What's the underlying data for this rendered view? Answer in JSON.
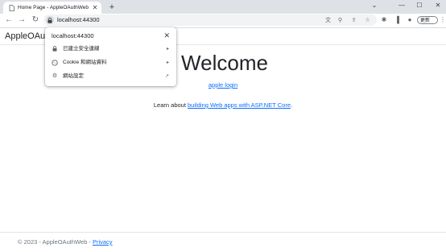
{
  "browser": {
    "tab_title": "Home Page - AppleOAuthWeb",
    "tab_close": "✕",
    "new_tab": "+",
    "url": "localhost:44300",
    "update_label": "更新",
    "window_controls": {
      "collapse": "⌄",
      "minimize": "—",
      "maximize": "☐",
      "close": "✕"
    }
  },
  "popup": {
    "host": "localhost:44300",
    "close": "✕",
    "items": [
      {
        "icon": "lock-icon",
        "label": "已建立安全連線",
        "end": "▸"
      },
      {
        "icon": "cookie-icon",
        "label": "Cookie 和網站資料",
        "end": "▸"
      },
      {
        "icon": "gear-icon",
        "label": "網站設定",
        "end": "↗"
      }
    ]
  },
  "page": {
    "brand": "AppleOAuthWeb",
    "heading": "Welcome",
    "apple_login": "apple login",
    "learn_prefix": "Learn about ",
    "learn_link": "building Web apps with ASP.NET Core",
    "learn_suffix": ".",
    "footer_prefix": "© 2023 - AppleOAuthWeb - ",
    "footer_link": "Privacy"
  },
  "colors": {
    "link": "#0d6efd",
    "tabstrip": "#dee1e6",
    "omnibox": "#f1f3f4"
  }
}
